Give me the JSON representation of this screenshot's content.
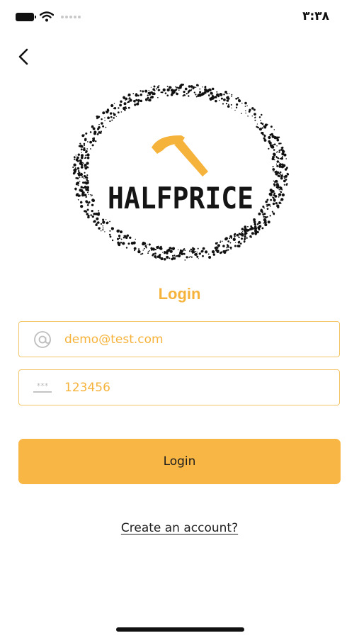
{
  "status_bar": {
    "time": "٣:٣٨"
  },
  "logo": {
    "brand_text": "HALFPRICE",
    "accent_color": "#f6b33b"
  },
  "login": {
    "title": "Login",
    "email_value": "demo@test.com",
    "password_value": "123456",
    "button_label": "Login",
    "create_account_link": "Create an account?"
  },
  "colors": {
    "accent": "#f8b645",
    "field_border": "#f3c769",
    "text": "#1f1f1f"
  },
  "icons": {
    "back": "chevron-left-icon",
    "email": "at-sign-icon",
    "password": "password-dots-icon"
  }
}
